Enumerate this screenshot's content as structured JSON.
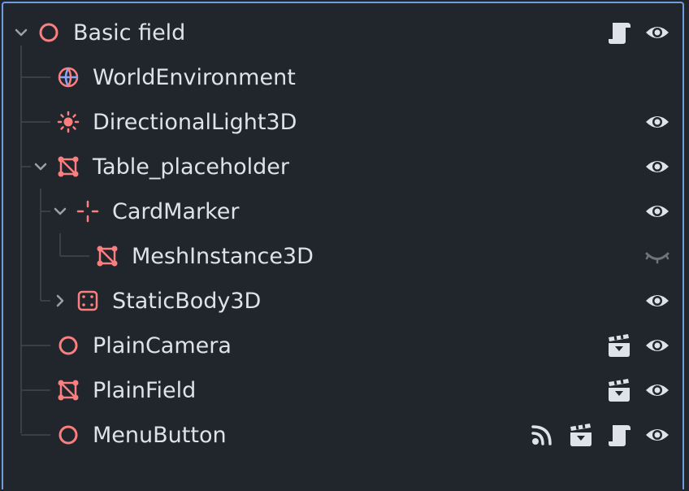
{
  "scene_tree": {
    "nodes": [
      {
        "label": "Basic field",
        "icon": "node3d-icon",
        "expanded": true,
        "indicators": [
          "script-icon",
          "visibility-eye-icon"
        ]
      },
      {
        "label": "WorldEnvironment",
        "icon": "world-environment-icon",
        "indicators": []
      },
      {
        "label": "DirectionalLight3D",
        "icon": "directional-light-icon",
        "indicators": [
          "visibility-eye-icon"
        ]
      },
      {
        "label": "Table_placeholder",
        "icon": "mesh-instance-icon",
        "expanded": true,
        "indicators": [
          "visibility-eye-icon"
        ]
      },
      {
        "label": "CardMarker",
        "icon": "marker3d-icon",
        "expanded": true,
        "indicators": [
          "visibility-eye-icon"
        ]
      },
      {
        "label": "MeshInstance3D",
        "icon": "mesh-instance-icon",
        "indicators": [
          "visibility-hidden-icon"
        ]
      },
      {
        "label": "StaticBody3D",
        "icon": "static-body-icon",
        "expanded": false,
        "indicators": [
          "visibility-eye-icon"
        ]
      },
      {
        "label": "PlainCamera",
        "icon": "node3d-icon",
        "indicators": [
          "instance-scene-icon",
          "visibility-eye-icon"
        ]
      },
      {
        "label": "PlainField",
        "icon": "mesh-instance-icon",
        "indicators": [
          "instance-scene-icon",
          "visibility-eye-icon"
        ]
      },
      {
        "label": "MenuButton",
        "icon": "node3d-icon",
        "indicators": [
          "signal-icon",
          "instance-scene-icon",
          "script-icon",
          "visibility-eye-icon"
        ]
      }
    ]
  },
  "colors": {
    "background": "#21252c",
    "border": "#6d9ee0",
    "text": "#dfe2e6",
    "node_icon": "#fc7f7f",
    "world_icon_blue": "#8da5f3",
    "indicator": "#dfe2e6",
    "guide_line": "#3a3f47"
  }
}
